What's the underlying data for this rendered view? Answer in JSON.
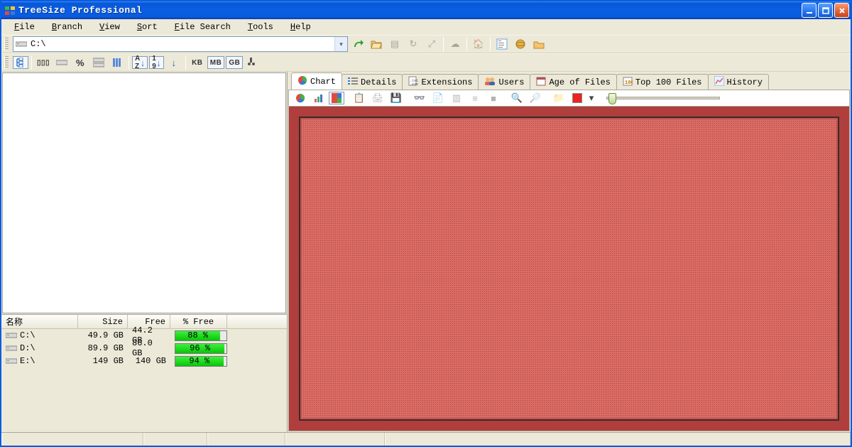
{
  "window": {
    "title": "TreeSize Professional"
  },
  "menu": [
    "File",
    "Branch",
    "View",
    "Sort",
    "File Search",
    "Tools",
    "Help"
  ],
  "address": {
    "value": "C:\\"
  },
  "unit_buttons": [
    "KB",
    "MB",
    "GB"
  ],
  "drive_grid": {
    "headers": {
      "name": "名称",
      "size": "Size",
      "free": "Free",
      "pct_free": "% Free"
    },
    "rows": [
      {
        "name": "C:\\",
        "size": "49.9 GB",
        "free": "44.2 GB",
        "pct": "88 %",
        "pct_val": 88
      },
      {
        "name": "D:\\",
        "size": "89.9 GB",
        "free": "86.0 GB",
        "pct": "96 %",
        "pct_val": 96
      },
      {
        "name": "E:\\",
        "size": "149 GB",
        "free": "140 GB",
        "pct": "94 %",
        "pct_val": 94
      }
    ]
  },
  "tabs": [
    {
      "label": "Chart",
      "icon": "pie-icon"
    },
    {
      "label": "Details",
      "icon": "list-icon"
    },
    {
      "label": "Extensions",
      "icon": "ext-icon"
    },
    {
      "label": "Users",
      "icon": "users-icon"
    },
    {
      "label": "Age of Files",
      "icon": "calendar-icon"
    },
    {
      "label": "Top 100 Files",
      "icon": "top-icon"
    },
    {
      "label": "History",
      "icon": "chart-icon"
    }
  ],
  "chart_data": {
    "type": "treemap",
    "title": "",
    "root": "C:\\",
    "note": "Treemap shows a single dominant block occupying the full area; no labeled subdivisions are visible.",
    "blocks": [
      {
        "label": "",
        "ratio": 1.0,
        "color": "#da6a62"
      }
    ]
  }
}
